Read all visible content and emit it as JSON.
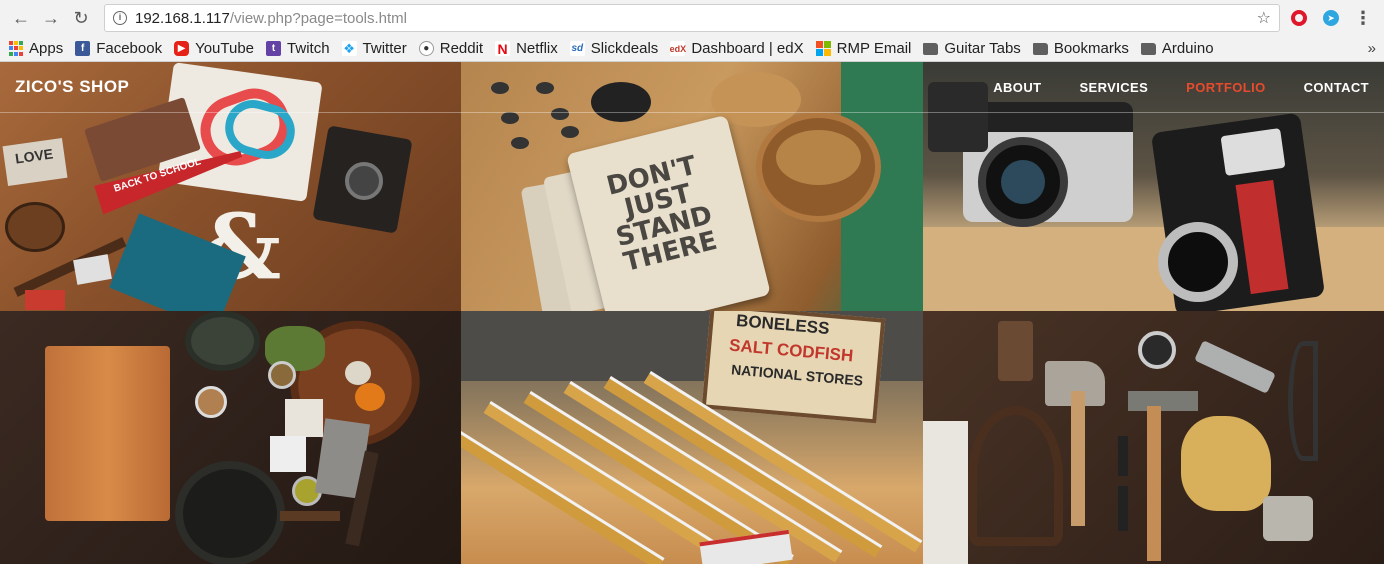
{
  "browser": {
    "url_host": "192.168.1.117",
    "url_path": "/view.php?page=tools.html",
    "back_icon": "back-arrow-icon",
    "forward_icon": "forward-arrow-icon",
    "reload_icon": "reload-icon"
  },
  "bookmarks": [
    {
      "label": "Apps",
      "icon": "apps-grid-icon"
    },
    {
      "label": "Facebook",
      "icon": "facebook-icon"
    },
    {
      "label": "YouTube",
      "icon": "youtube-icon"
    },
    {
      "label": "Twitch",
      "icon": "twitch-icon"
    },
    {
      "label": "Twitter",
      "icon": "twitter-icon"
    },
    {
      "label": "Reddit",
      "icon": "reddit-icon"
    },
    {
      "label": "Netflix",
      "icon": "netflix-icon"
    },
    {
      "label": "Slickdeals",
      "icon": "slickdeals-icon"
    },
    {
      "label": "Dashboard | edX",
      "icon": "edx-icon"
    },
    {
      "label": "RMP Email",
      "icon": "microsoft-icon"
    },
    {
      "label": "Guitar Tabs",
      "icon": "folder-icon"
    },
    {
      "label": "Bookmarks",
      "icon": "folder-icon"
    },
    {
      "label": "Arduino",
      "icon": "folder-icon"
    }
  ],
  "site": {
    "brand": "ZICO'S SHOP",
    "menu": [
      {
        "label": "ABOUT",
        "active": false
      },
      {
        "label": "SERVICES",
        "active": false
      },
      {
        "label": "PORTFOLIO",
        "active": true
      },
      {
        "label": "CONTACT",
        "active": false
      }
    ],
    "accent_color": "#e84b2c"
  },
  "gallery": {
    "tiles": [
      {
        "subject": "workspace-flatlay",
        "texts": [
          "BACK TO SCHOOL",
          "LOVE",
          "&"
        ]
      },
      {
        "subject": "notebooks",
        "texts": [
          "DON'T JUST STAND THERE"
        ]
      },
      {
        "subject": "vintage-cameras",
        "texts": []
      },
      {
        "subject": "kitchen-board",
        "texts": []
      },
      {
        "subject": "folding-rulers",
        "texts": [
          "BONELESS",
          "SALT CODFISH",
          "NATIONAL STORES"
        ]
      },
      {
        "subject": "hand-tools",
        "texts": []
      }
    ]
  }
}
